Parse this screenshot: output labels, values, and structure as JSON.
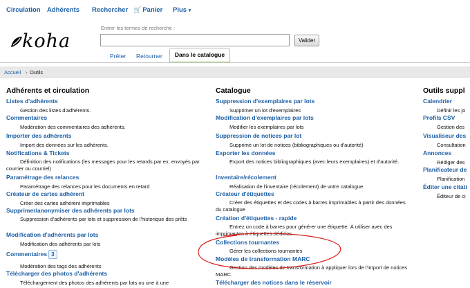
{
  "nav": {
    "circulation": "Circulation",
    "patrons": "Adhérents",
    "search": "Rechercher",
    "cart": "Panier",
    "more": "Plus"
  },
  "logo": {
    "text": "koha"
  },
  "search": {
    "hint": "Entrer les termes de recherche :",
    "value": "",
    "submit": "Valider"
  },
  "tabs": {
    "checkout": "Prêter",
    "checkin": "Retourner",
    "catalog": "Dans le catalogue"
  },
  "breadcrumb": {
    "home": "Accueil",
    "separator": "›",
    "current": "Outils"
  },
  "columns": {
    "patrons": {
      "title": "Adhérents et circulation",
      "items": [
        {
          "link": "Listes d'adhérents",
          "desc": "Gestion des listes d'adhérents."
        },
        {
          "link": "Commentaires",
          "desc": "Modération des commentaires des adhérents."
        },
        {
          "link": "Importer des adhérents",
          "desc": "Import des données sur les adhérents."
        },
        {
          "link": "Notifications & Tickets",
          "desc": "Définition des notifications (les messages pour les retards par ex. envoyés par courrier ou courriel)"
        },
        {
          "link": "Paramétrage des relances",
          "desc": "Paramétrage des relances pour les documents en retard"
        },
        {
          "link": "Créateur de cartes adhérent",
          "desc": "Créer des cartes adhérent imprimables"
        },
        {
          "link": "Supprimer/anonymiser des adhérents par lots",
          "desc": "Suppression d'adhérents par lots et suppression de l'historique des prêts"
        },
        {
          "link": "Modification d'adhérents par lots",
          "desc": "Modification des adhérents par lots"
        },
        {
          "link": "Commentaires",
          "badge": "3",
          "desc": "Modération des tags des adhérents"
        },
        {
          "link": "Télécharger des photos d'adhérents",
          "desc": "Téléchargement des photos des adhérents par lots ou une à une"
        }
      ]
    },
    "catalog": {
      "title": "Catalogue",
      "items": [
        {
          "link": "Suppression d'exemplaires par lots",
          "desc": "Supprimer un lot d'exemplaires"
        },
        {
          "link": "Modification d'exemplaires par lots",
          "desc": "Modifier les exemplaires par lots"
        },
        {
          "link": "Suppression de notices par lot",
          "desc": "Supprime un lot de notices (bibliographiques ou d'autorité)"
        },
        {
          "link": "Exporter les données",
          "desc": "Export des notices bibliographiques (avec leurs exemplaires) et d'autorité."
        },
        {
          "link": "Inventaire/récolement",
          "desc": "Réalisation de l'inventaire (récolement) de votre catalogue"
        },
        {
          "link": "Créateur d'étiquettes",
          "desc": "Créer des étiquettes et des codes à barres imprimables à partir des données du catalogue"
        },
        {
          "link": "Création d'étiquettes - rapide",
          "desc": "Entrez un code à barres pour générer une étiquette. À utiliser avec des imprimantes à étiquettes dédiées"
        },
        {
          "link": "Collections tournantes",
          "desc": "Gérer les collections tournantes"
        },
        {
          "link": "Modèles de transformation MARC",
          "desc": "Gestion des modèles de transformation à appliquer lors de l'import de notices MARC."
        },
        {
          "link": "Télécharger des notices dans le réservoir",
          "desc": ""
        }
      ]
    },
    "additional": {
      "title": "Outils suppl",
      "items": [
        {
          "link": "Calendrier",
          "desc": "Définir les jo"
        },
        {
          "link": "Profils CSV",
          "desc": "Gestion des"
        },
        {
          "link": "Visualiseur des",
          "desc": "Consultation"
        },
        {
          "link": "Annonces",
          "desc": "Rédiger des"
        },
        {
          "link": "Planificateur de",
          "desc": "Planification"
        },
        {
          "link": "Éditer une citati",
          "desc": "Éditeur de ci"
        }
      ]
    }
  },
  "colors": {
    "link": "#1d5fa6",
    "annotation": "#d9201c",
    "active_tab": "#8fcf68"
  }
}
